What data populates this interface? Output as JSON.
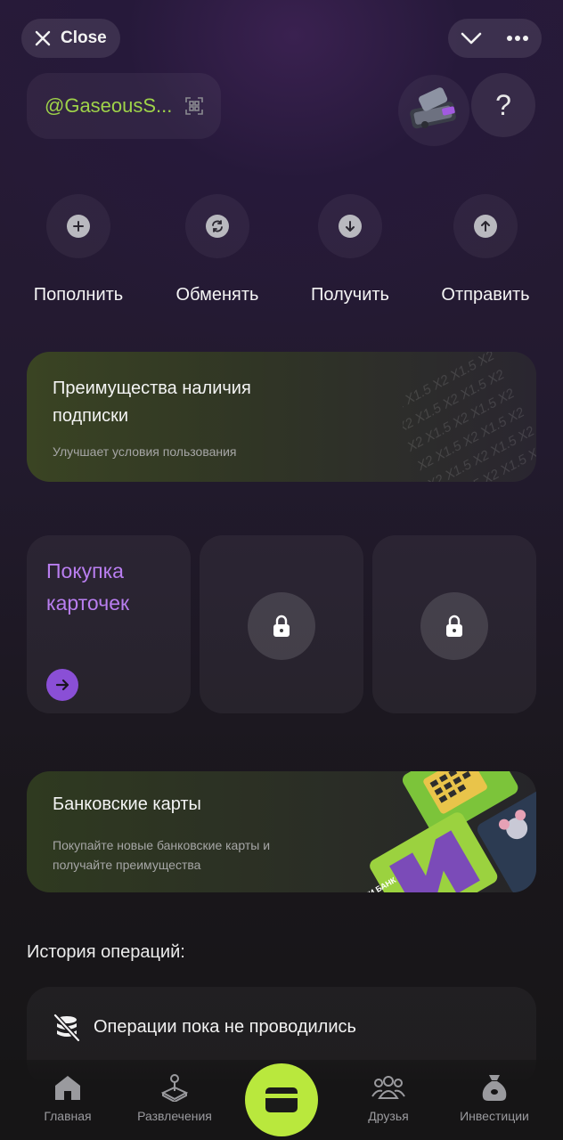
{
  "topbar": {
    "close_label": "Close"
  },
  "profile": {
    "username": "@GaseousS...",
    "help_label": "?"
  },
  "actions": [
    {
      "label": "Пополнить",
      "icon": "plus-icon"
    },
    {
      "label": "Обменять",
      "icon": "exchange-icon"
    },
    {
      "label": "Получить",
      "icon": "arrow-down-icon"
    },
    {
      "label": "Отправить",
      "icon": "arrow-up-icon"
    }
  ],
  "subscription_card": {
    "title": "Преимущества наличия подписки",
    "description": "Улучшает условия пользования",
    "pattern_text": "X2 X1.5 X2 X1.5 X2"
  },
  "tiles": {
    "buy_cards_title": "Покупка карточек"
  },
  "bank_card": {
    "title": "Банковские карты",
    "description": "Покупайте новые банковские карты и получайте преимущества",
    "card_brand_text": "ГНИ БАНК"
  },
  "history": {
    "label": "История операций:",
    "empty_text": "Операции пока не проводились"
  },
  "bottom_nav": [
    {
      "label": "Главная",
      "icon": "home-icon"
    },
    {
      "label": "Развлечения",
      "icon": "joystick-icon"
    },
    {
      "label": "Друзья",
      "icon": "friends-icon"
    },
    {
      "label": "Инвестиции",
      "icon": "money-bag-icon"
    }
  ],
  "colors": {
    "accent_green": "#b9e83d",
    "username_green": "#9fd349",
    "accent_purple": "#8a4fd6",
    "tile_purple_text": "#b97ef0"
  }
}
